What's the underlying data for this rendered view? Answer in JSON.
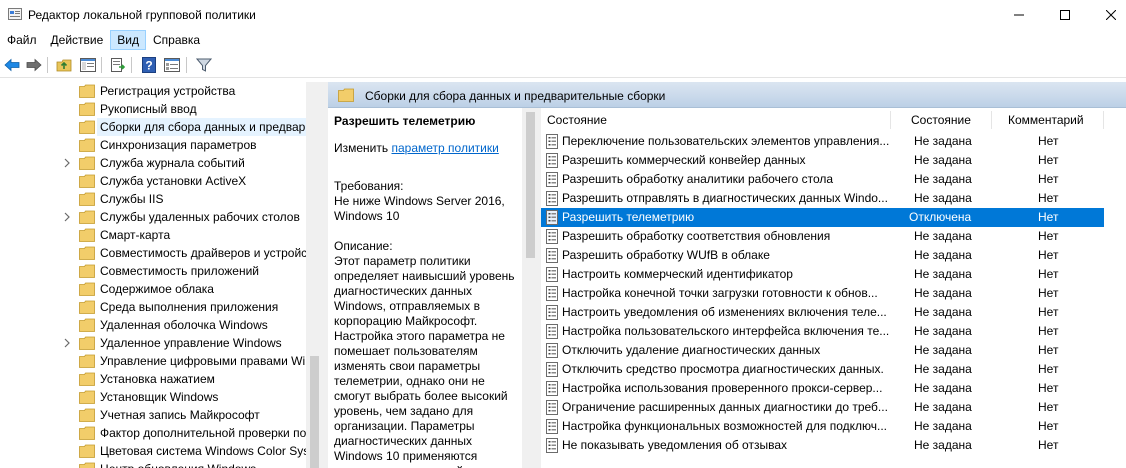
{
  "window": {
    "title": "Редактор локальной групповой политики"
  },
  "menu": {
    "items": [
      "Файл",
      "Действие",
      "Вид",
      "Справка"
    ],
    "active_index": 2
  },
  "toolbar": {
    "icons": [
      "back-arrow-icon",
      "forward-arrow-icon",
      "folder-up-icon",
      "show-hide-tree-icon",
      "export-list-icon",
      "help-icon",
      "properties-view-icon",
      "filter-icon"
    ]
  },
  "tree": {
    "items": [
      {
        "label": "Регистрация устройства",
        "expandable": false
      },
      {
        "label": "Рукописный ввод",
        "expandable": false
      },
      {
        "label": "Сборки для сбора данных и предвари",
        "expandable": false,
        "selected": true
      },
      {
        "label": "Синхронизация параметров",
        "expandable": false
      },
      {
        "label": "Служба журнала событий",
        "expandable": true
      },
      {
        "label": "Служба установки ActiveX",
        "expandable": false
      },
      {
        "label": "Службы IIS",
        "expandable": false
      },
      {
        "label": "Службы удаленных рабочих столов",
        "expandable": true
      },
      {
        "label": "Смарт-карта",
        "expandable": false
      },
      {
        "label": "Совместимость драйверов и устройс",
        "expandable": false
      },
      {
        "label": "Совместимость приложений",
        "expandable": false
      },
      {
        "label": "Содержимое облака",
        "expandable": false
      },
      {
        "label": "Среда выполнения приложения",
        "expandable": false
      },
      {
        "label": "Удаленная оболочка Windows",
        "expandable": false
      },
      {
        "label": "Удаленное управление Windows",
        "expandable": true
      },
      {
        "label": "Управление цифровыми правами Wi",
        "expandable": false
      },
      {
        "label": "Установка нажатием",
        "expandable": false
      },
      {
        "label": "Установщик Windows",
        "expandable": false
      },
      {
        "label": "Учетная запись Майкрософт",
        "expandable": false
      },
      {
        "label": "Фактор дополнительной проверки по",
        "expandable": false
      },
      {
        "label": "Цветовая система Windows Color Syst",
        "expandable": false
      },
      {
        "label": "Центр обновления Windows",
        "expandable": false
      }
    ]
  },
  "right": {
    "header_title": "Сборки для сбора данных и предварительные сборки"
  },
  "description": {
    "title": "Разрешить телеметрию",
    "edit_prefix": "Изменить",
    "edit_link": "параметр политики",
    "requirements_label": "Требования:",
    "requirements_text": "Не ниже Windows Server 2016, Windows 10",
    "description_label": "Описание:",
    "description_lines": [
      "Этот параметр политики",
      "определяет наивысший уровень",
      "диагностических данных",
      "Windows, отправляемых в",
      "корпорацию Майкрософт.",
      "Настройка этого параметра не",
      "помешает пользователям",
      "изменять свои параметры",
      "телеметрии, однако они не",
      "смогут выбрать более высокий",
      "уровень, чем задано для",
      "организации. Параметры",
      "диагностических данных",
      "Windows 10 применяются",
      "только к операционной системе"
    ]
  },
  "list": {
    "columns": {
      "name": "Состояние",
      "state": "Состояние",
      "comment": "Комментарий"
    },
    "rows": [
      {
        "name": "Переключение пользовательских элементов управления...",
        "state": "Не задана",
        "comment": "Нет"
      },
      {
        "name": "Разрешить коммерческий конвейер данных",
        "state": "Не задана",
        "comment": "Нет"
      },
      {
        "name": "Разрешить обработку аналитики рабочего стола",
        "state": "Не задана",
        "comment": "Нет"
      },
      {
        "name": "Разрешить отправлять в диагностических данных Windo...",
        "state": "Не задана",
        "comment": "Нет"
      },
      {
        "name": "Разрешить телеметрию",
        "state": "Отключена",
        "comment": "Нет",
        "selected": true
      },
      {
        "name": "Разрешить обработку соответствия обновления",
        "state": "Не задана",
        "comment": "Нет"
      },
      {
        "name": "Разрешить обработку WUfB в облаке",
        "state": "Не задана",
        "comment": "Нет"
      },
      {
        "name": "Настроить коммерческий идентификатор",
        "state": "Не задана",
        "comment": "Нет"
      },
      {
        "name": "Настройка конечной точки загрузки готовности к обнов...",
        "state": "Не задана",
        "comment": "Нет"
      },
      {
        "name": "Настроить уведомления об изменениях включения телe...",
        "state": "Не задана",
        "comment": "Нет"
      },
      {
        "name": "Настройка пользовательского интерфейса включения те...",
        "state": "Не задана",
        "comment": "Нет"
      },
      {
        "name": "Отключить удаление диагностических данных",
        "state": "Не задана",
        "comment": "Нет"
      },
      {
        "name": "Отключить средство просмотра диагностических данных.",
        "state": "Не задана",
        "comment": "Нет"
      },
      {
        "name": "Настройка использования проверенного прокси-сервер...",
        "state": "Не задана",
        "comment": "Нет"
      },
      {
        "name": "Ограничение расширенных данных диагностики до треб...",
        "state": "Не задана",
        "comment": "Нет"
      },
      {
        "name": "Настройка функциональных возможностей для подключ...",
        "state": "Не задана",
        "comment": "Нет"
      },
      {
        "name": "Не показывать уведомления об отзывах",
        "state": "Не задана",
        "comment": "Нет"
      }
    ]
  }
}
